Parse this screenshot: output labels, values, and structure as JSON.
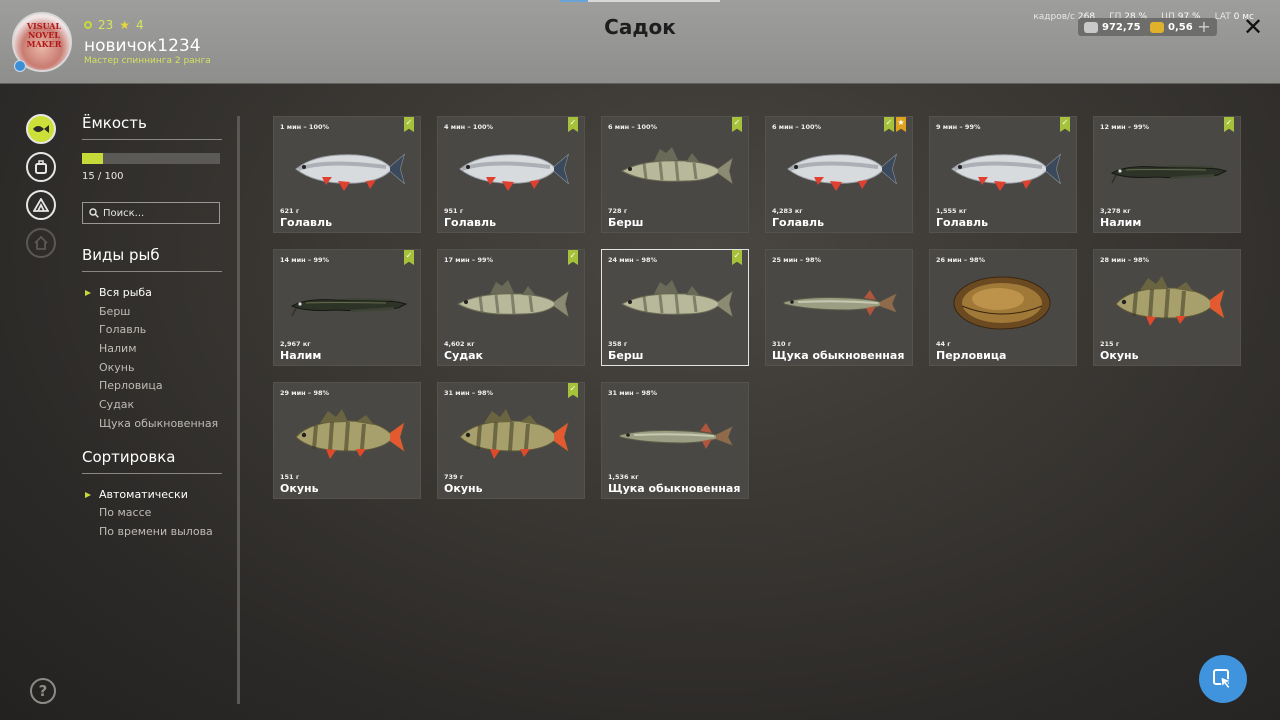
{
  "header": {
    "title": "Садок",
    "player": {
      "avatar_logo_text": "VISUAL NOVEL MAKER",
      "level": "23",
      "stars": "4",
      "username": "новичок1234",
      "rank": "Мастер спиннинга 2 ранга"
    },
    "metrics": [
      {
        "label": "кадров/с",
        "value": "268"
      },
      {
        "label": "ГП",
        "value": "28 %"
      },
      {
        "label": "ЦП",
        "value": "97 %"
      },
      {
        "label": "LAT",
        "value": "0 мс"
      }
    ],
    "silver": "972,75",
    "gold": "0,56",
    "plus_label": "+",
    "close_label": "✕",
    "colors": {
      "silver_coin": "#c9c9c9",
      "gold_coin": "#e0b12a"
    }
  },
  "sidebar_icons": [
    {
      "name": "fish-keepnet-icon",
      "state": "active"
    },
    {
      "name": "bag-icon",
      "state": "normal"
    },
    {
      "name": "camp-icon",
      "state": "normal"
    },
    {
      "name": "house-icon",
      "state": "disabled"
    }
  ],
  "help_label": "?",
  "capacity": {
    "title": "Ёмкость",
    "current": 15,
    "max": 100,
    "label": "15 / 100"
  },
  "search": {
    "placeholder": "Поиск..."
  },
  "species": {
    "title": "Виды рыб",
    "items": [
      "Вся рыба",
      "Берш",
      "Голавль",
      "Налим",
      "Окунь",
      "Перловица",
      "Судак",
      "Щука обыкновенная"
    ],
    "selected": "Вся рыба"
  },
  "sort": {
    "title": "Сортировка",
    "items": [
      "Автоматически",
      "По массе",
      "По времени вылова"
    ],
    "selected": "Автоматически"
  },
  "fish": [
    {
      "time": "1 мин – 100%",
      "weight": "621 г",
      "name": "Голавль",
      "kind": "chub",
      "badges": [
        "green"
      ]
    },
    {
      "time": "4 мин – 100%",
      "weight": "951 г",
      "name": "Голавль",
      "kind": "chub",
      "badges": [
        "green"
      ]
    },
    {
      "time": "6 мин – 100%",
      "weight": "728 г",
      "name": "Берш",
      "kind": "zander",
      "badges": [
        "green"
      ]
    },
    {
      "time": "6 мин – 100%",
      "weight": "4,283 кг",
      "name": "Голавль",
      "kind": "chub",
      "badges": [
        "green",
        "gold"
      ]
    },
    {
      "time": "9 мин – 99%",
      "weight": "1,555 кг",
      "name": "Голавль",
      "kind": "chub",
      "badges": [
        "green"
      ]
    },
    {
      "time": "12 мин – 99%",
      "weight": "3,278 кг",
      "name": "Налим",
      "kind": "burbot",
      "badges": [
        "green"
      ]
    },
    {
      "time": "14 мин – 99%",
      "weight": "2,967 кг",
      "name": "Налим",
      "kind": "burbot",
      "badges": [
        "green"
      ]
    },
    {
      "time": "17 мин – 99%",
      "weight": "4,602 кг",
      "name": "Судак",
      "kind": "zander",
      "badges": [
        "green"
      ]
    },
    {
      "time": "24 мин – 98%",
      "weight": "358 г",
      "name": "Берш",
      "kind": "zander",
      "badges": [
        "green"
      ],
      "highlight": true
    },
    {
      "time": "25 мин – 98%",
      "weight": "310 г",
      "name": "Щука обыкновенная",
      "kind": "pike",
      "badges": []
    },
    {
      "time": "26 мин – 98%",
      "weight": "44 г",
      "name": "Перловица",
      "kind": "mussel",
      "badges": []
    },
    {
      "time": "28 мин – 98%",
      "weight": "215 г",
      "name": "Окунь",
      "kind": "perch",
      "badges": []
    },
    {
      "time": "29 мин – 98%",
      "weight": "151 г",
      "name": "Окунь",
      "kind": "perch",
      "badges": []
    },
    {
      "time": "31 мин – 98%",
      "weight": "739 г",
      "name": "Окунь",
      "kind": "perch",
      "badges": [
        "green"
      ]
    },
    {
      "time": "31 мин – 98%",
      "weight": "1,536 кг",
      "name": "Щука обыкновенная",
      "kind": "pike",
      "badges": []
    }
  ]
}
